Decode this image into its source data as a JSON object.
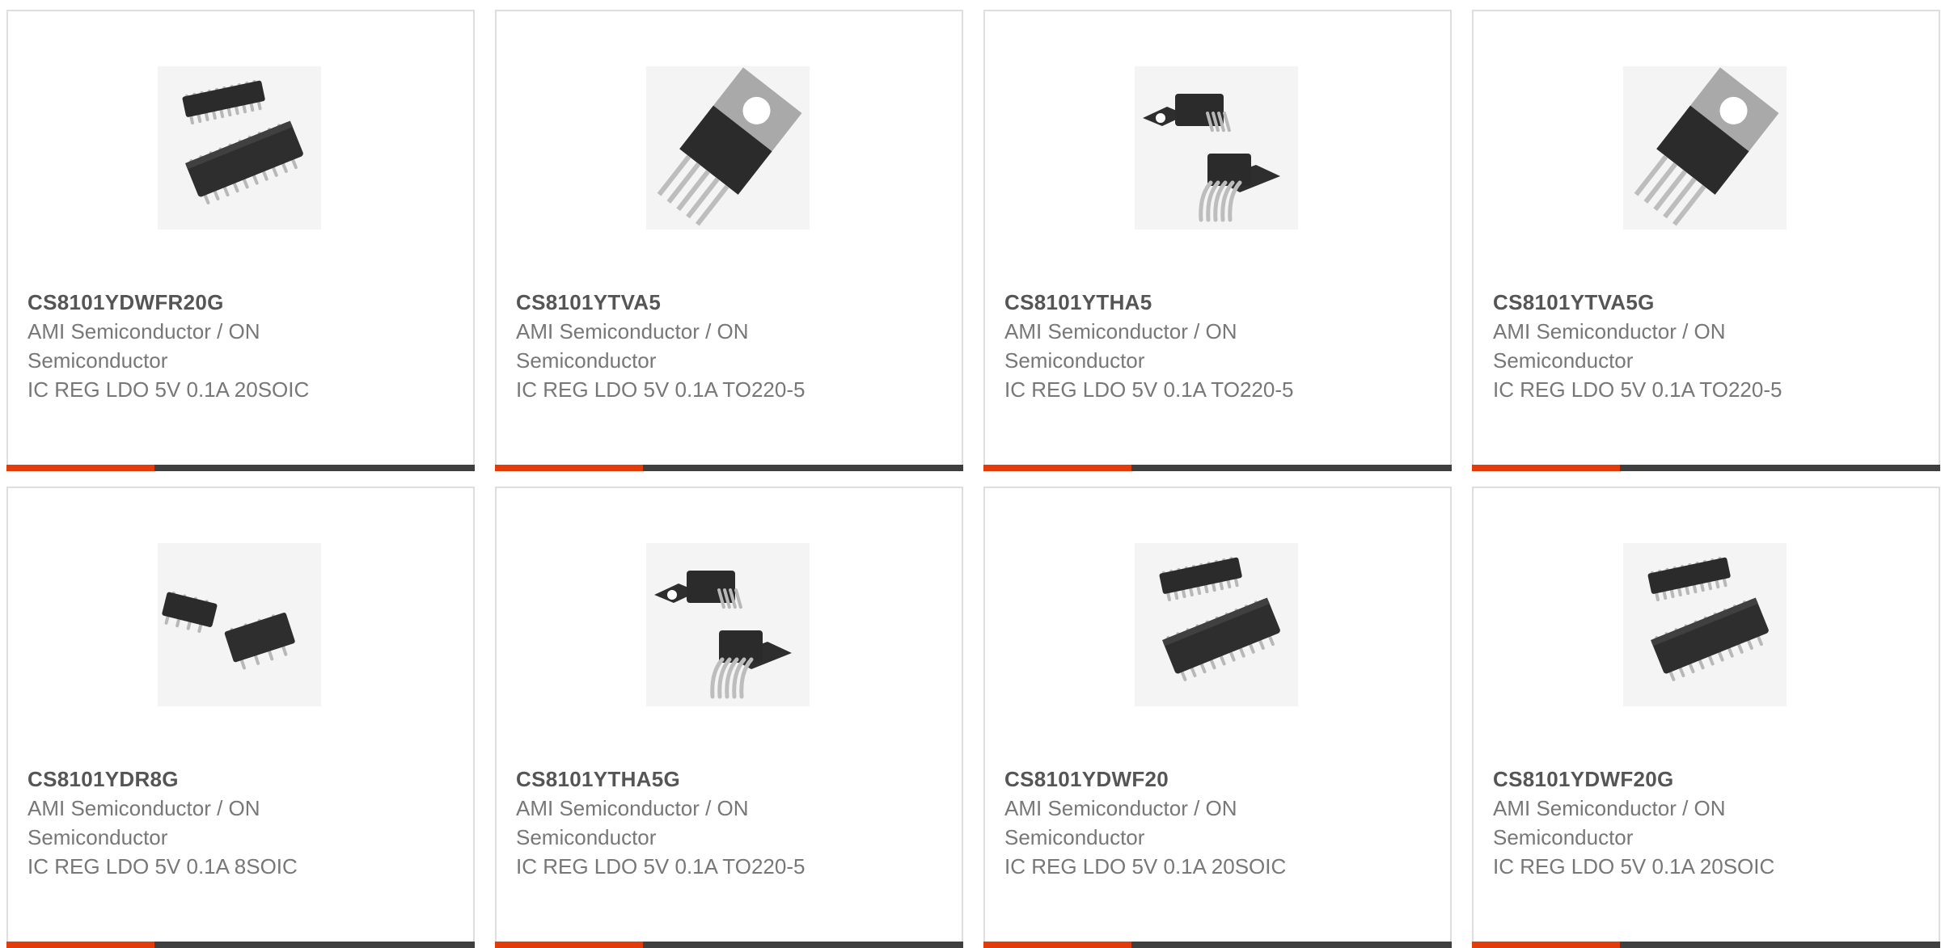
{
  "colors": {
    "accent": "#e33b0a",
    "bar": "#3f3f3f",
    "border": "#dedede",
    "text": "#777777",
    "title": "#555555"
  },
  "products": [
    {
      "part": "CS8101YDWFR20G",
      "manufacturer": "AMI Semiconductor / ON Semiconductor",
      "description": "IC REG LDO 5V 0.1A 20SOIC",
      "image": "soic-20-package"
    },
    {
      "part": "CS8101YTVA5",
      "manufacturer": "AMI Semiconductor / ON Semiconductor",
      "description": "IC REG LDO 5V 0.1A TO220-5",
      "image": "to220-5-package"
    },
    {
      "part": "CS8101YTHA5",
      "manufacturer": "AMI Semiconductor / ON Semiconductor",
      "description": "IC REG LDO 5V 0.1A TO220-5",
      "image": "to220-5-horizontal-package"
    },
    {
      "part": "CS8101YTVA5G",
      "manufacturer": "AMI Semiconductor / ON Semiconductor",
      "description": "IC REG LDO 5V 0.1A TO220-5",
      "image": "to220-5-package"
    },
    {
      "part": "CS8101YDR8G",
      "manufacturer": "AMI Semiconductor / ON Semiconductor",
      "description": "IC REG LDO 5V 0.1A 8SOIC",
      "image": "soic-8-package"
    },
    {
      "part": "CS8101YTHA5G",
      "manufacturer": "AMI Semiconductor / ON Semiconductor",
      "description": "IC REG LDO 5V 0.1A TO220-5",
      "image": "to220-5-horizontal-package"
    },
    {
      "part": "CS8101YDWF20",
      "manufacturer": "AMI Semiconductor / ON Semiconductor",
      "description": "IC REG LDO 5V 0.1A 20SOIC",
      "image": "soic-20-package"
    },
    {
      "part": "CS8101YDWF20G",
      "manufacturer": "AMI Semiconductor / ON Semiconductor",
      "description": "IC REG LDO 5V 0.1A 20SOIC",
      "image": "soic-20-package"
    }
  ]
}
